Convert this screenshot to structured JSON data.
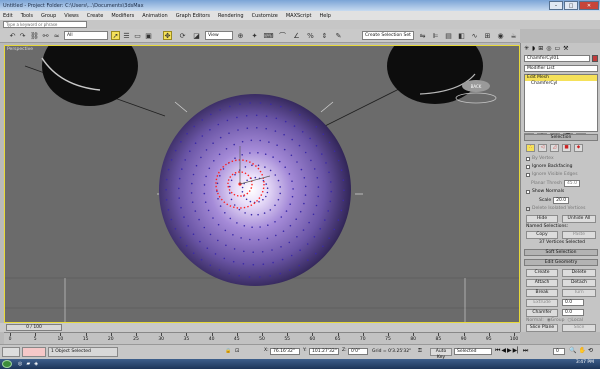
{
  "window": {
    "title": "Untitled - Project Folder: C:\\Users\\...\\Documents\\3dsMax",
    "controls": {
      "minimize": "–",
      "maximize": "□",
      "close": "✕"
    }
  },
  "menu": [
    "Edit",
    "Tools",
    "Group",
    "Views",
    "Create",
    "Modifiers",
    "Animation",
    "Graph Editors",
    "Rendering",
    "Customize",
    "MAXScript",
    "Help"
  ],
  "search": {
    "placeholder": "Type a keyword or phrase"
  },
  "toolbar": {
    "selection_filter": "All",
    "coord_system": "View",
    "named_selection": "Create Selection Set"
  },
  "viewport": {
    "label": "Perspective",
    "viewcube_label": "BACK"
  },
  "command_panel": {
    "object_name": "ChamferCyl01",
    "modifier_list": "Modifier List",
    "stack": [
      {
        "label": "Edit Mesh",
        "selected": true
      },
      {
        "label": "ChamferCyl",
        "selected": false
      }
    ],
    "selection_rollup": "Selection",
    "by_vertex": "By Vertex",
    "ignore_backfacing": "Ignore Backfacing",
    "ignore_visible_edges": "Ignore Visible Edges",
    "planar_thresh_label": "Planar Thresh",
    "planar_thresh_value": "45.0",
    "show_normals": "Show Normals",
    "scale_label": "Scale",
    "scale_value": "20.0",
    "delete_isolated": "Delete Isolated Vertices",
    "hide": "Hide",
    "unhide_all": "Unhide All",
    "named_selections": "Named Selections:",
    "copy": "Copy",
    "paste": "Paste",
    "selection_status": "37 Vertices Selected",
    "soft_selection": "Soft Selection",
    "edit_geometry": "Edit Geometry",
    "create": "Create",
    "delete": "Delete",
    "attach": "Attach",
    "detach": "Detach",
    "break": "Break",
    "turn": "Turn",
    "extrude": "Extrude",
    "extrude_value": "0.0",
    "chamfer": "Chamfer",
    "chamfer_value": "0.0",
    "normal_label": "Normal:",
    "group": "Group",
    "local": "Local",
    "slice_plane": "Slice Plane",
    "slice": "Slice"
  },
  "timeline": {
    "slider_label": "0 / 100",
    "ticks": [
      "0",
      "5",
      "10",
      "15",
      "20",
      "25",
      "30",
      "35",
      "40",
      "45",
      "50",
      "55",
      "60",
      "65",
      "70",
      "75",
      "80",
      "85",
      "90",
      "95",
      "100"
    ]
  },
  "status": {
    "selected": "1 Object Selected",
    "x_label": "X:",
    "x_value": "76.16'32\"",
    "y_label": "Y:",
    "y_value": "101.27'32\"",
    "z_label": "Z:",
    "z_value": "0'0\"",
    "grid": "Grid = 0'3.25'32\"",
    "autokey": "Auto Key",
    "autokey_mode": "Selected",
    "set_key": "Set Key",
    "key_filters": "Key Filters...",
    "frame": "0"
  },
  "taskbar": {
    "clock": "3:47 PM"
  },
  "colors": {
    "selection_yellow": "#f5e15a",
    "vertex_red": "#ff2020",
    "sphere_purple": "#9d84d6"
  }
}
